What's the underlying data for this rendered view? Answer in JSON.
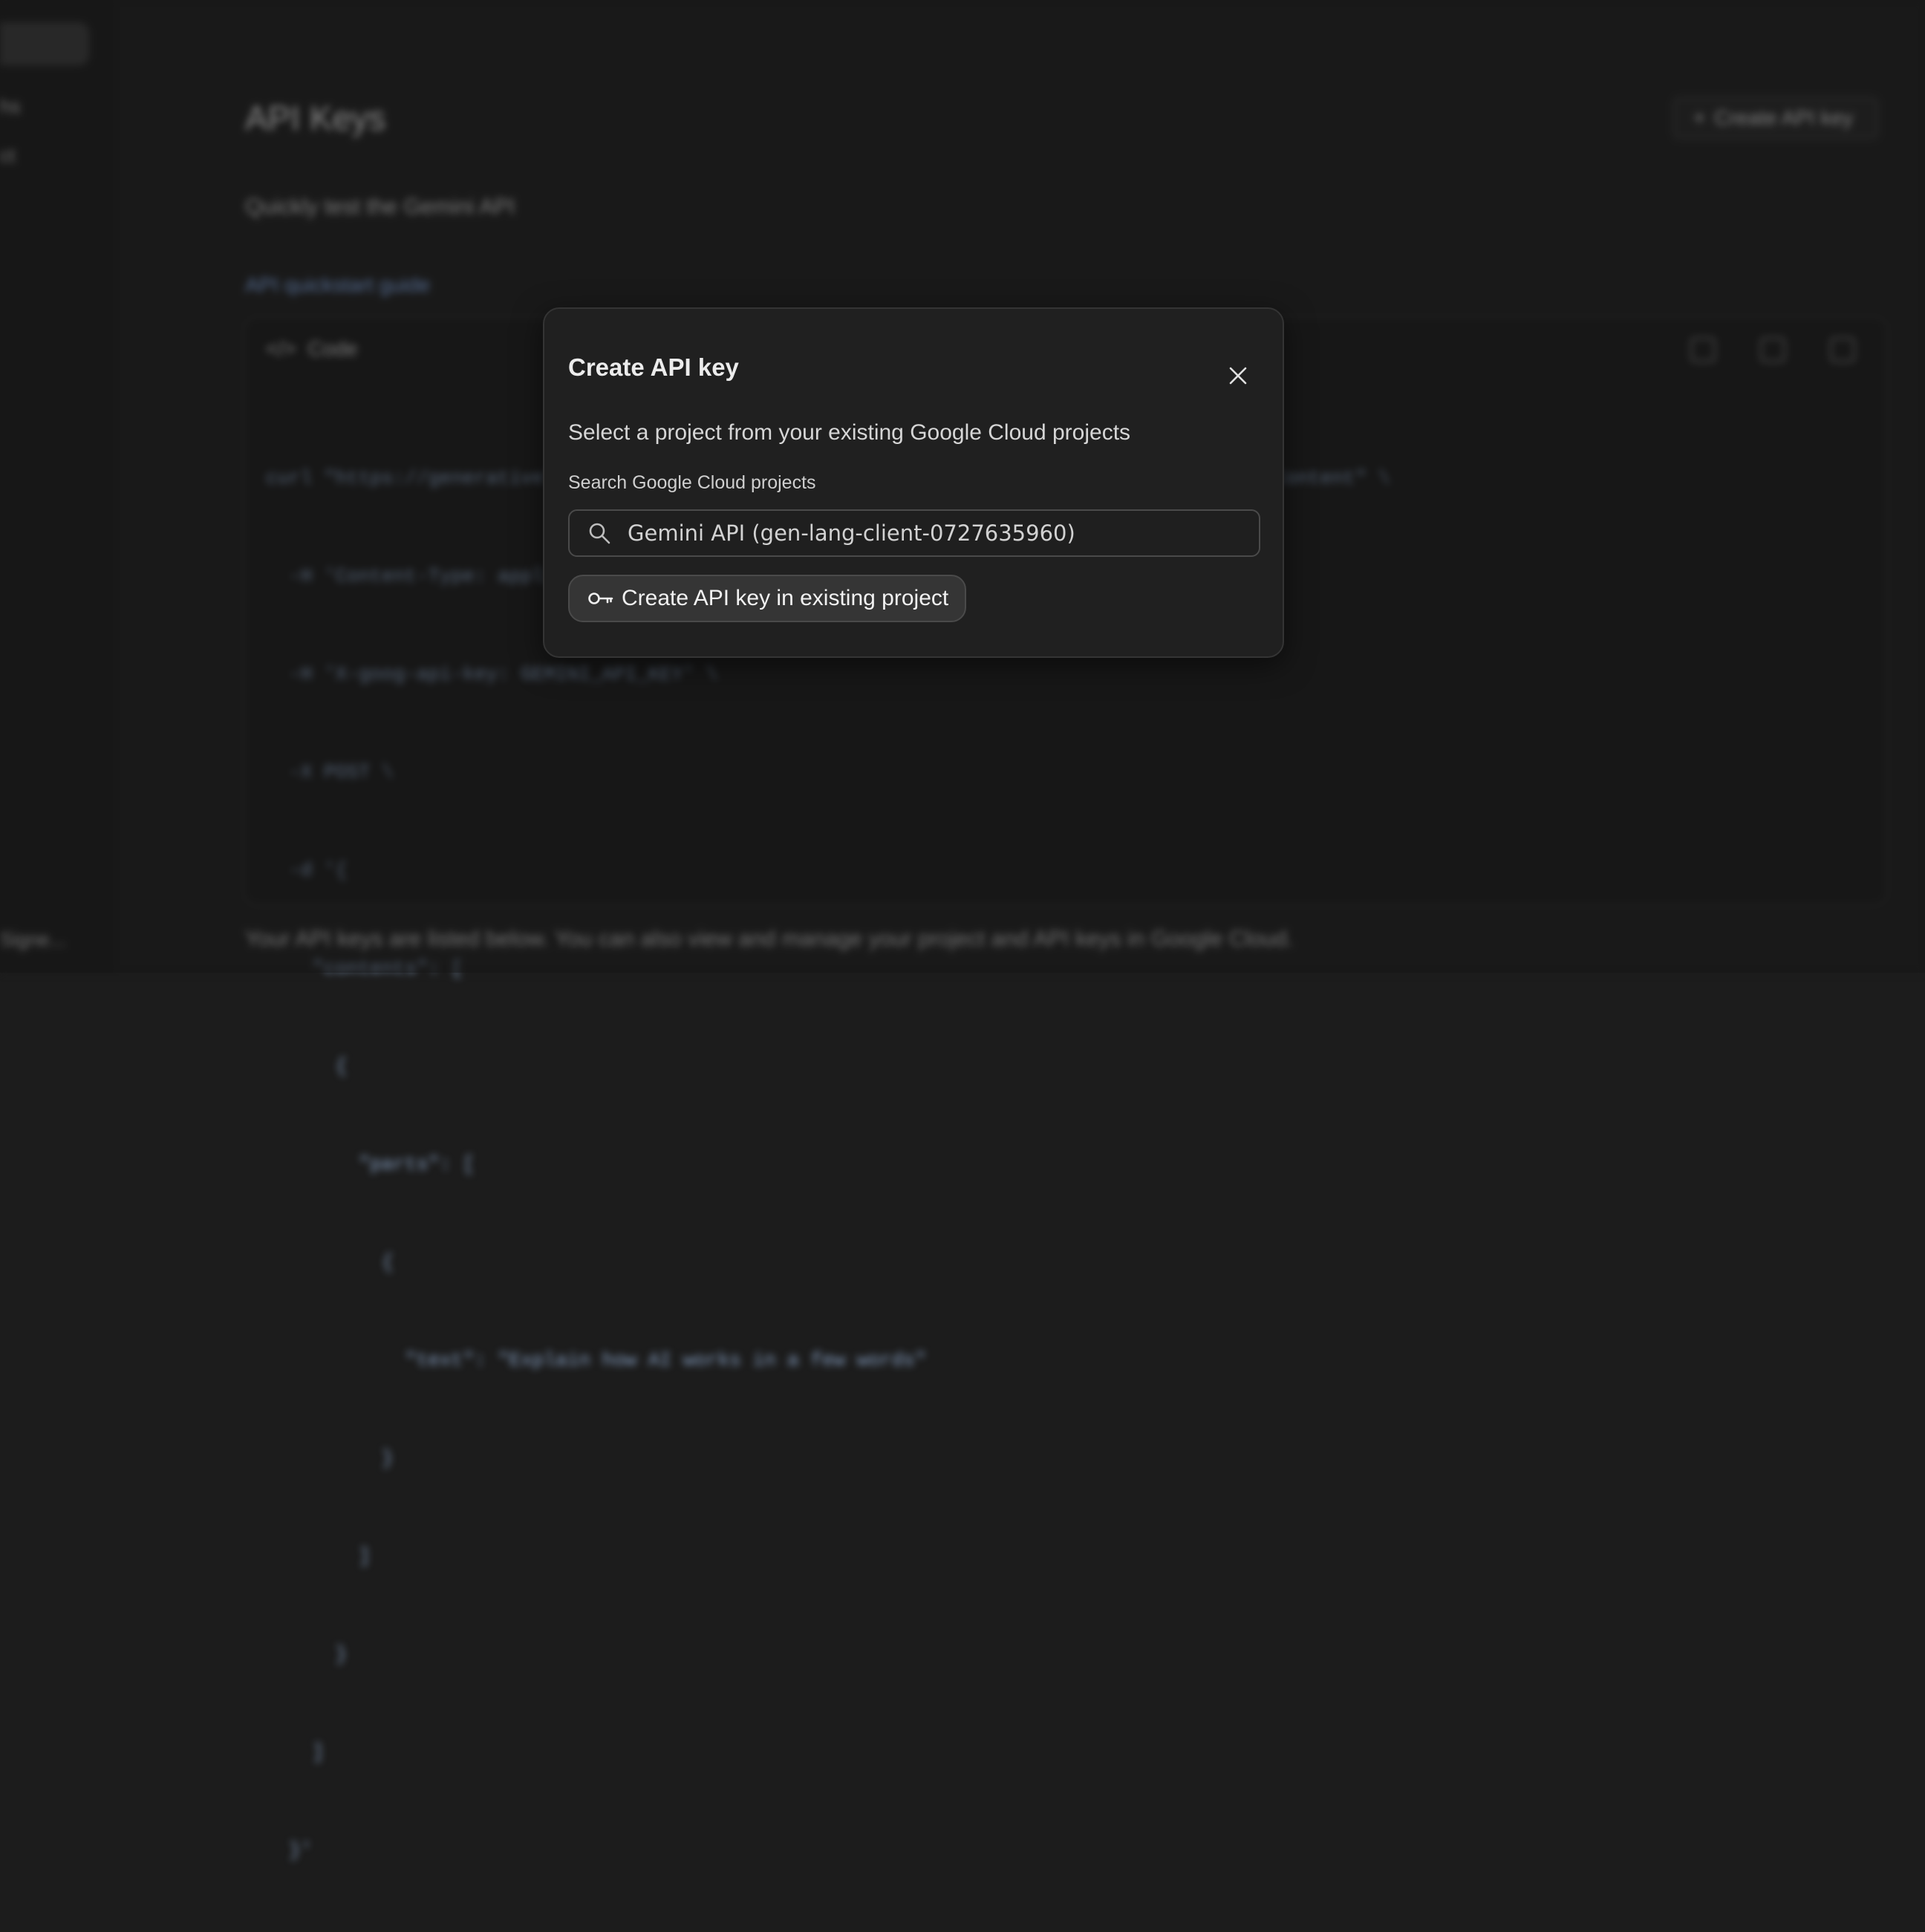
{
  "background": {
    "sidebar": {
      "items": [
        "hs",
        "ct"
      ],
      "footer": "Signe..."
    },
    "page_title": "API Keys",
    "create_button_label": "Create API key",
    "subtitle": "Quickly test the Gemini API",
    "guide_link": "API quickstart guide",
    "code_card": {
      "tab_label": "Code",
      "lines": [
        "curl \"https://generativelanguage.googleapis.com/v1beta/models/gemini-2.0-flash:generateContent\" \\",
        "  -H 'Content-Type: application/json' \\",
        "  -H 'X-goog-api-key: GEMINI_API_KEY' \\",
        "  -X POST \\",
        "  -d '{",
        "    \"contents\": [",
        "      {",
        "        \"parts\": [",
        "          {",
        "            \"text\": \"Explain how AI works in a few words\"",
        "          }",
        "        ]",
        "      }",
        "    ]",
        "  }'"
      ]
    },
    "footer_note": "Your API keys are listed below. You can also view and manage your project and API keys in Google Cloud."
  },
  "dialog": {
    "title": "Create API key",
    "description": "Select a project from your existing Google Cloud projects",
    "search_label": "Search Google Cloud projects",
    "search_value": "Gemini API (gen-lang-client-0727635960)",
    "create_button_label": "Create API key in existing project",
    "icons": {
      "close": "close-icon",
      "search": "search-icon",
      "key": "key-icon"
    }
  }
}
